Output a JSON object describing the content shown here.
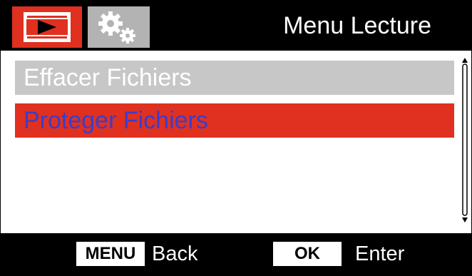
{
  "header": {
    "title": "Menu Lecture",
    "tabs": [
      {
        "icon": "playback-film-icon",
        "active": true,
        "color": "#e03020"
      },
      {
        "icon": "gears-icon",
        "active": false,
        "color": "#b3b3b3"
      }
    ]
  },
  "menu": {
    "items": [
      {
        "label": "Effacer Fichiers",
        "state": "normal"
      },
      {
        "label": "Proteger Fichiers",
        "state": "selected"
      }
    ]
  },
  "scrollbar": {
    "up_icon": "arrow-up-icon",
    "down_icon": "arrow-down-icon"
  },
  "footer": {
    "menu_key": "MENU",
    "menu_action": "Back",
    "ok_key": "OK",
    "ok_action": "Enter"
  },
  "colors": {
    "selected_bg": "#e03020",
    "selected_text": "#3b3dc9",
    "normal_bg": "#c7c7c7",
    "normal_text": "#ffffff",
    "bar_bg": "#000000"
  }
}
